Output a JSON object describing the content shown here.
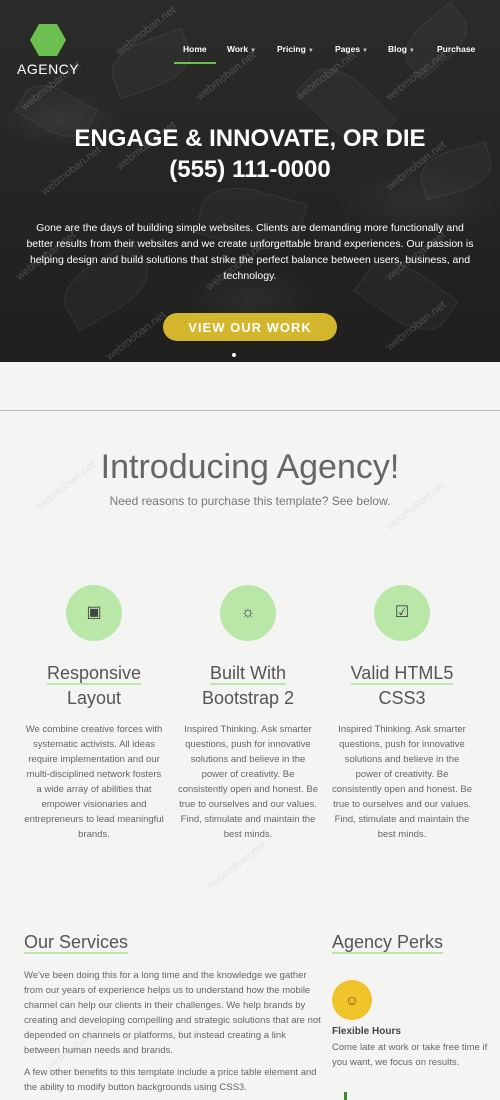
{
  "brand": {
    "name": "AGENCY"
  },
  "nav": {
    "items": [
      {
        "label": "Home",
        "dropdown": false
      },
      {
        "label": "Work",
        "dropdown": true
      },
      {
        "label": "Pricing",
        "dropdown": true
      },
      {
        "label": "Pages",
        "dropdown": true
      },
      {
        "label": "Blog",
        "dropdown": true
      },
      {
        "label": "Purchase",
        "dropdown": false
      }
    ],
    "active": "Home"
  },
  "hero": {
    "title": "ENGAGE & INNOVATE, OR DIE",
    "phone": "(555) 111-0000",
    "text": "Gone are the days of building simple websites. Clients are demanding more functionally and better results from their websites and we create unforgettable brand experiences. Our passion is helping design and build solutions that strike the perfect balance between users, business, and technology.",
    "cta": "VIEW OUR WORK"
  },
  "watermark": "webmoban.net",
  "intro": {
    "title": "Introducing Agency!",
    "subtitle": "Need reasons to purchase this template? See below."
  },
  "features": [
    {
      "icon": "layout-icon",
      "title_line1": "Responsive",
      "title_line2": "Layout",
      "text": "We combine creative forces with systematic activists. All ideas require implementation and our multi-disciplined network fosters a wide array of abilities that empower visionaries and entrepreneurs to lead meaningful brands."
    },
    {
      "icon": "sun-icon",
      "title_line1": "Built With",
      "title_line2": "Bootstrap 2",
      "text": "Inspired Thinking. Ask smarter questions, push for innovative solutions and believe in the power of creativity. Be consistently open and honest. Be true to ourselves and our values. Find, stimulate and maintain the best minds."
    },
    {
      "icon": "checkbox-icon",
      "title_line1": "Valid HTML5",
      "title_line2": "CSS3",
      "text": "Inspired Thinking. Ask smarter questions, push for innovative solutions and believe in the power of creativity. Be consistently open and honest. Be true to ourselves and our values. Find, stimulate and maintain the best minds."
    }
  ],
  "services": {
    "heading": "Our Services",
    "p1": "We've been doing this for a long time and the knowledge we gather from our years of experience helps us to understand how the mobile channel can help our clients in their challenges. We help brands by creating and developing compelling and strategic solutions that are not depended on channels or platforms, but instead creating a link between human needs and brands.",
    "p2": "A few other benefits to this template include a price table element and the ability to modify button backgrounds using CSS3."
  },
  "perks": {
    "heading": "Agency Perks",
    "items": [
      {
        "icon": "smiley-icon",
        "title": "Flexible Hours",
        "text": "Come late at work or take free time if you want, we focus on results."
      }
    ]
  },
  "colors": {
    "accent": "#6bbf4f",
    "accent_light": "#b8e7a8",
    "cta": "#d4b62c"
  }
}
